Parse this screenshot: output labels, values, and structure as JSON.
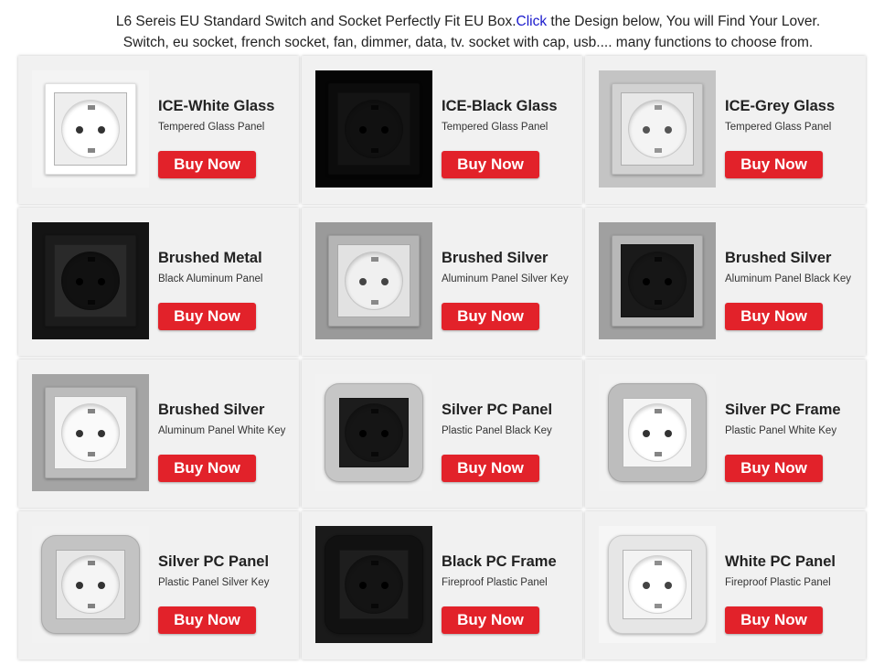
{
  "intro": {
    "line1_before": "L6 Sereis EU Standard Switch and Socket Perfectly Fit EU Box.",
    "line1_link": "Click",
    "line1_after": " the Design below, You will Find Your Lover.",
    "line2": "Switch, eu socket, french socket, fan, dimmer, data, tv. socket with cap, usb.... many functions to choose from."
  },
  "products": [
    {
      "title": "ICE-White Glass",
      "subtitle": "Tempered Glass Panel",
      "button": "Buy Now",
      "icon": "white-glass-socket-icon",
      "colors": {
        "bg": "#f4f4f4",
        "plate": "#ffffff",
        "well": "#eeeeee",
        "face": "#ffffff",
        "hole": "#333333"
      }
    },
    {
      "title": "ICE-Black Glass",
      "subtitle": "Tempered Glass Panel",
      "button": "Buy Now",
      "icon": "black-glass-socket-icon",
      "colors": {
        "bg": "#050505",
        "plate": "#0c0c0c",
        "well": "#141414",
        "face": "#111111",
        "hole": "#000000"
      }
    },
    {
      "title": "ICE-Grey Glass",
      "subtitle": "Tempered Glass Panel",
      "button": "Buy Now",
      "icon": "grey-glass-socket-icon",
      "colors": {
        "bg": "#c4c4c4",
        "plate": "#d2d2d2",
        "well": "#e8e8e8",
        "face": "#f4f4f4",
        "hole": "#555555"
      }
    },
    {
      "title": "Brushed Metal",
      "subtitle": "Black Aluminum Panel",
      "button": "Buy Now",
      "icon": "brushed-black-socket-icon",
      "colors": {
        "bg": "#141414",
        "plate": "#1c1c1c",
        "well": "#2a2a2a",
        "face": "#111111",
        "hole": "#000000"
      }
    },
    {
      "title": "Brushed Silver",
      "subtitle": "Aluminum Panel Silver Key",
      "button": "Buy Now",
      "icon": "brushed-silver-socket-icon",
      "colors": {
        "bg": "#9a9a9a",
        "plate": "#b5b5b5",
        "well": "#e2e2e2",
        "face": "#f0f0f0",
        "hole": "#444444"
      }
    },
    {
      "title": "Brushed Silver",
      "subtitle": "Aluminum Panel Black Key",
      "button": "Buy Now",
      "icon": "brushed-silver-black-key-socket-icon",
      "colors": {
        "bg": "#a0a0a0",
        "plate": "#b8b8b8",
        "well": "#1a1a1a",
        "face": "#161616",
        "hole": "#000000"
      }
    },
    {
      "title": "Brushed Silver",
      "subtitle": "Aluminum Panel White Key",
      "button": "Buy Now",
      "icon": "brushed-silver-white-key-socket-icon",
      "colors": {
        "bg": "#a4a4a4",
        "plate": "#bcbcbc",
        "well": "#f2f2f2",
        "face": "#fafafa",
        "hole": "#333333"
      }
    },
    {
      "title": "Silver PC Panel",
      "subtitle": "Plastic Panel Black Key",
      "button": "Buy Now",
      "icon": "silver-pc-black-key-socket-icon",
      "colors": {
        "bg": "#f2f2f2",
        "plate": "#c6c6c6",
        "well": "#1c1c1c",
        "face": "#151515",
        "hole": "#000000"
      }
    },
    {
      "title": "Silver PC Frame",
      "subtitle": "Plastic Panel White Key",
      "button": "Buy Now",
      "icon": "silver-pc-frame-socket-icon",
      "colors": {
        "bg": "#f2f2f2",
        "plate": "#bdbdbd",
        "well": "#f4f4f4",
        "face": "#ffffff",
        "hole": "#333333"
      }
    },
    {
      "title": "Silver PC Panel",
      "subtitle": "Plastic Panel Silver Key",
      "button": "Buy Now",
      "icon": "silver-pc-silver-key-socket-icon",
      "colors": {
        "bg": "#f2f2f2",
        "plate": "#c3c3c3",
        "well": "#e6e6e6",
        "face": "#f5f5f5",
        "hole": "#333333"
      }
    },
    {
      "title": "Black PC Frame",
      "subtitle": "Fireproof Plastic Panel",
      "button": "Buy Now",
      "icon": "black-pc-frame-socket-icon",
      "colors": {
        "bg": "#1a1a1a",
        "plate": "#111111",
        "well": "#1e1e1e",
        "face": "#141414",
        "hole": "#000000"
      }
    },
    {
      "title": "White PC Panel",
      "subtitle": "Fireproof Plastic Panel",
      "button": "Buy Now",
      "icon": "white-pc-panel-socket-icon",
      "colors": {
        "bg": "#f6f6f6",
        "plate": "#e6e6e6",
        "well": "#f3f3f3",
        "face": "#ffffff",
        "hole": "#444444"
      }
    }
  ]
}
